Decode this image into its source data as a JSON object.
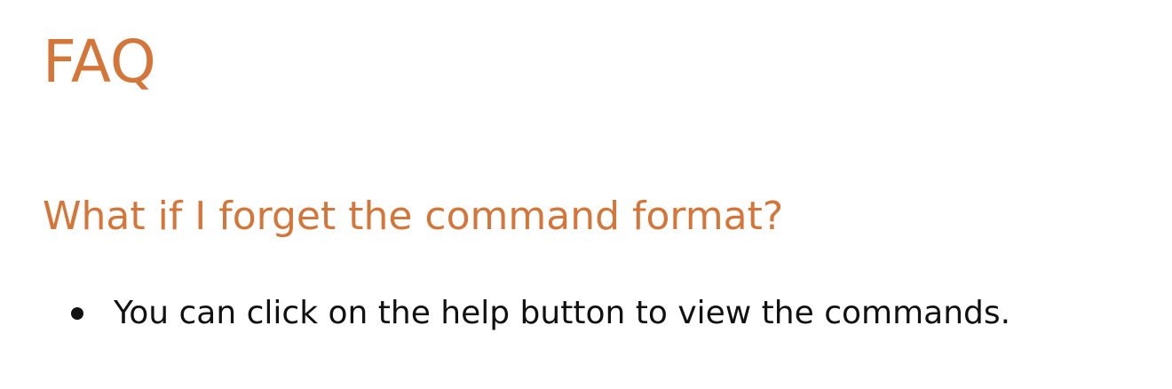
{
  "faq": {
    "title": "FAQ",
    "items": [
      {
        "question": "What if I forget the command format?",
        "answers": [
          "You can click on the help button to view the commands."
        ]
      }
    ]
  },
  "colors": {
    "heading_accent": "#d4763a",
    "body_text": "#111111",
    "background": "#ffffff"
  }
}
